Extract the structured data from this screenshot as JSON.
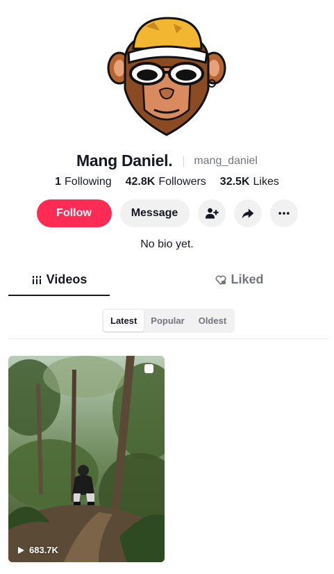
{
  "profile": {
    "display_name": "Mang Daniel.",
    "username": "mang_daniel",
    "bio": "No bio yet.",
    "avatar_icon": "monkey-bucket-hat-sunglasses-avatar"
  },
  "stats": {
    "following_count": "1",
    "following_label": "Following",
    "followers_count": "42.8K",
    "followers_label": "Followers",
    "likes_count": "32.5K",
    "likes_label": "Likes"
  },
  "actions": {
    "follow_label": "Follow",
    "message_label": "Message",
    "add_friend_icon": "add-person-icon",
    "share_icon": "share-arrow-icon",
    "more_icon": "more-dots-icon"
  },
  "tabs": [
    {
      "label": "Videos",
      "icon": "grid-lines-icon",
      "active": true
    },
    {
      "label": "Liked",
      "icon": "heart-lock-icon",
      "active": false
    }
  ],
  "sort": {
    "options": [
      "Latest",
      "Popular",
      "Oldest"
    ],
    "selected": "Latest"
  },
  "videos": [
    {
      "views": "683.7K"
    }
  ],
  "colors": {
    "accent": "#fe2c55",
    "text_primary": "#161823",
    "text_secondary": "#73757c",
    "button_bg": "#f1f1f2"
  }
}
